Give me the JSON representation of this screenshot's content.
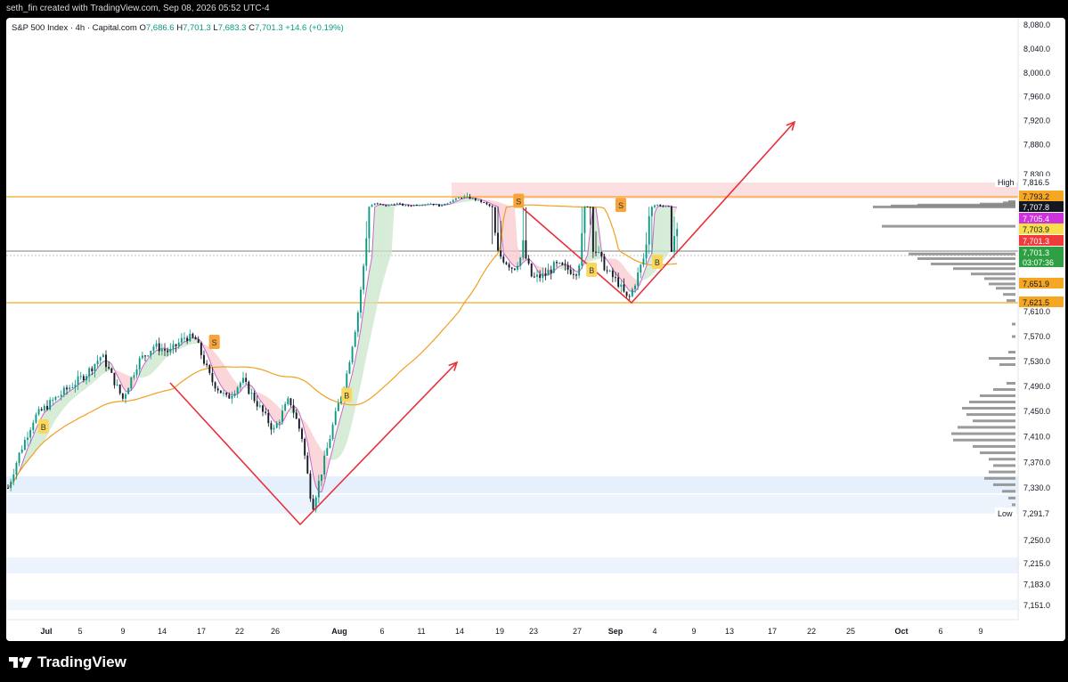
{
  "header": {
    "created_text": "seth_fin created with TradingView.com, Sep 08, 2026 05:52 UTC-4"
  },
  "legend": {
    "symbol": "S&P 500 Index · 4h · Capital.com",
    "o_label": "O",
    "o_value": "7,686.6",
    "h_label": "H",
    "h_value": "7,701.3",
    "l_label": "L",
    "l_value": "7,683.3",
    "c_label": "C",
    "c_value": "7,701.3",
    "change": "+14.6 (+0.19%)"
  },
  "brand": {
    "name": "TradingView"
  },
  "colors": {
    "up": "#089981",
    "down": "#131722",
    "arrow": "#e8303a",
    "orange_line": "#f5a623",
    "ma_orange": "#f0a020",
    "ma_purple": "#cc66cc",
    "green_band": "#c8e6c9",
    "red_band": "#f8c8cc",
    "blue_zone": "#dbe8fb",
    "signal": "#f7a43a",
    "signal_buy": "#f9d65c"
  },
  "chart_data": {
    "type": "candlestick",
    "title": "S&P 500 Index · 4h · Capital.com",
    "y_ticks": [
      "8,080.0",
      "8,040.0",
      "8,000.0",
      "7,960.0",
      "7,920.0",
      "7,880.0",
      "7,830.0",
      "7,610.0",
      "7,570.0",
      "7,530.0",
      "7,490.0",
      "7,450.0",
      "7,410.0",
      "7,370.0",
      "7,330.0",
      "7,250.0",
      "7,215.0",
      "7,183.0",
      "7,151.0"
    ],
    "y_tick_values": [
      8080,
      8040,
      8000,
      7960,
      7920,
      7880,
      7830,
      7610,
      7570,
      7530,
      7490,
      7450,
      7410,
      7370,
      7330,
      7250,
      7215,
      7183,
      7151
    ],
    "x_ticks": [
      "Jul",
      "5",
      "9",
      "14",
      "17",
      "22",
      "26",
      "Aug",
      "6",
      "11",
      "14",
      "19",
      "23",
      "27",
      "Sep",
      "4",
      "9",
      "13",
      "17",
      "22",
      "25",
      "Oct",
      "6",
      "9"
    ],
    "x_tick_bold": [
      "Jul",
      "Aug",
      "Sep",
      "Oct"
    ],
    "price_labels": [
      {
        "label": "High",
        "value": "7,816.5",
        "kind": "plain"
      },
      {
        "label": "",
        "value": "7,793.2",
        "kind": "orange"
      },
      {
        "label": "",
        "value": "7,707.8",
        "kind": "black"
      },
      {
        "label": "",
        "value": "7,705.4",
        "kind": "purple"
      },
      {
        "label": "",
        "value": "7,703.9",
        "kind": "yellow"
      },
      {
        "label": "",
        "value": "7,701.3",
        "kind": "red"
      },
      {
        "label": "",
        "value": "7,701.3",
        "kind": "green"
      },
      {
        "label": "",
        "value": "03:07:36",
        "kind": "green"
      },
      {
        "label": "",
        "value": "7,651.9",
        "kind": "orange"
      },
      {
        "label": "",
        "value": "7,621.5",
        "kind": "orange"
      },
      {
        "label": "Low",
        "value": "7,291.7",
        "kind": "plain"
      }
    ],
    "price_label_values": [
      7816.5,
      7793.2,
      7707.8,
      7705.4,
      7703.9,
      7701.3,
      7701.3,
      7701.3,
      7651.9,
      7621.5,
      7291.7
    ],
    "horizontal_levels": [
      7793.2,
      7621.5,
      7701.3
    ],
    "signals": [
      {
        "text": "B",
        "price": 7425,
        "x_frac": 0.034
      },
      {
        "text": "S",
        "price": 7560,
        "x_frac": 0.198
      },
      {
        "text": "B",
        "price": 7475,
        "x_frac": 0.325
      },
      {
        "text": "S",
        "price": 7754,
        "x_frac": 0.49
      },
      {
        "text": "B",
        "price": 7672,
        "x_frac": 0.56
      },
      {
        "text": "S",
        "price": 7721,
        "x_frac": 0.588
      },
      {
        "text": "B",
        "price": 7684,
        "x_frac": 0.623
      }
    ],
    "ohlc_last": {
      "open": 7686.6,
      "high": 7701.3,
      "low": 7683.3,
      "close": 7701.3
    },
    "path": [
      [
        0,
        7330
      ],
      [
        0.01,
        7380
      ],
      [
        0.025,
        7440
      ],
      [
        0.045,
        7470
      ],
      [
        0.06,
        7490
      ],
      [
        0.075,
        7510
      ],
      [
        0.09,
        7540
      ],
      [
        0.1,
        7505
      ],
      [
        0.11,
        7470
      ],
      [
        0.125,
        7530
      ],
      [
        0.14,
        7555
      ],
      [
        0.155,
        7545
      ],
      [
        0.17,
        7570
      ],
      [
        0.18,
        7565
      ],
      [
        0.195,
        7500
      ],
      [
        0.21,
        7470
      ],
      [
        0.225,
        7500
      ],
      [
        0.24,
        7460
      ],
      [
        0.255,
        7420
      ],
      [
        0.27,
        7470
      ],
      [
        0.282,
        7410
      ],
      [
        0.292,
        7300
      ],
      [
        0.3,
        7350
      ],
      [
        0.312,
        7430
      ],
      [
        0.325,
        7510
      ],
      [
        0.335,
        7600
      ],
      [
        0.343,
        7700
      ],
      [
        0.352,
        7740
      ],
      [
        0.362,
        7720
      ],
      [
        0.372,
        7740
      ],
      [
        0.382,
        7720
      ],
      [
        0.392,
        7730
      ],
      [
        0.405,
        7740
      ],
      [
        0.415,
        7720
      ],
      [
        0.425,
        7760
      ],
      [
        0.435,
        7790
      ],
      [
        0.445,
        7780
      ],
      [
        0.455,
        7750
      ],
      [
        0.465,
        7705
      ],
      [
        0.475,
        7690
      ],
      [
        0.485,
        7675
      ],
      [
        0.495,
        7700
      ],
      [
        0.503,
        7660
      ],
      [
        0.515,
        7665
      ],
      [
        0.525,
        7680
      ],
      [
        0.535,
        7675
      ],
      [
        0.545,
        7670
      ],
      [
        0.555,
        7720
      ],
      [
        0.565,
        7700
      ],
      [
        0.575,
        7670
      ],
      [
        0.585,
        7655
      ],
      [
        0.595,
        7625
      ],
      [
        0.603,
        7660
      ],
      [
        0.612,
        7700
      ],
      [
        0.622,
        7730
      ],
      [
        0.632,
        7712
      ],
      [
        0.642,
        7701
      ]
    ],
    "volume_profile": [
      {
        "price": 7755,
        "width": 8
      },
      {
        "price": 7745,
        "width": 14
      },
      {
        "price": 7735,
        "width": 40
      },
      {
        "price": 7727,
        "width": 110
      },
      {
        "price": 7720,
        "width": 140
      },
      {
        "price": 7712,
        "width": 160
      },
      {
        "price": 7705,
        "width": 150
      },
      {
        "price": 7697,
        "width": 120
      },
      {
        "price": 7690,
        "width": 110
      },
      {
        "price": 7682,
        "width": 95
      },
      {
        "price": 7675,
        "width": 70
      },
      {
        "price": 7667,
        "width": 50
      },
      {
        "price": 7660,
        "width": 35
      },
      {
        "price": 7652,
        "width": 30
      },
      {
        "price": 7645,
        "width": 22
      },
      {
        "price": 7635,
        "width": 14
      },
      {
        "price": 7625,
        "width": 10
      },
      {
        "price": 7590,
        "width": 4
      },
      {
        "price": 7570,
        "width": 4
      },
      {
        "price": 7545,
        "width": 8
      },
      {
        "price": 7535,
        "width": 30
      },
      {
        "price": 7525,
        "width": 18
      },
      {
        "price": 7495,
        "width": 10
      },
      {
        "price": 7485,
        "width": 25
      },
      {
        "price": 7475,
        "width": 40
      },
      {
        "price": 7465,
        "width": 52
      },
      {
        "price": 7455,
        "width": 60
      },
      {
        "price": 7445,
        "width": 55
      },
      {
        "price": 7435,
        "width": 48
      },
      {
        "price": 7425,
        "width": 65
      },
      {
        "price": 7415,
        "width": 72
      },
      {
        "price": 7405,
        "width": 70
      },
      {
        "price": 7395,
        "width": 48
      },
      {
        "price": 7385,
        "width": 40
      },
      {
        "price": 7375,
        "width": 30
      },
      {
        "price": 7365,
        "width": 25
      },
      {
        "price": 7355,
        "width": 30
      },
      {
        "price": 7345,
        "width": 35
      },
      {
        "price": 7335,
        "width": 25
      },
      {
        "price": 7325,
        "width": 15
      },
      {
        "price": 7315,
        "width": 8
      },
      {
        "price": 7305,
        "width": 4
      }
    ]
  }
}
